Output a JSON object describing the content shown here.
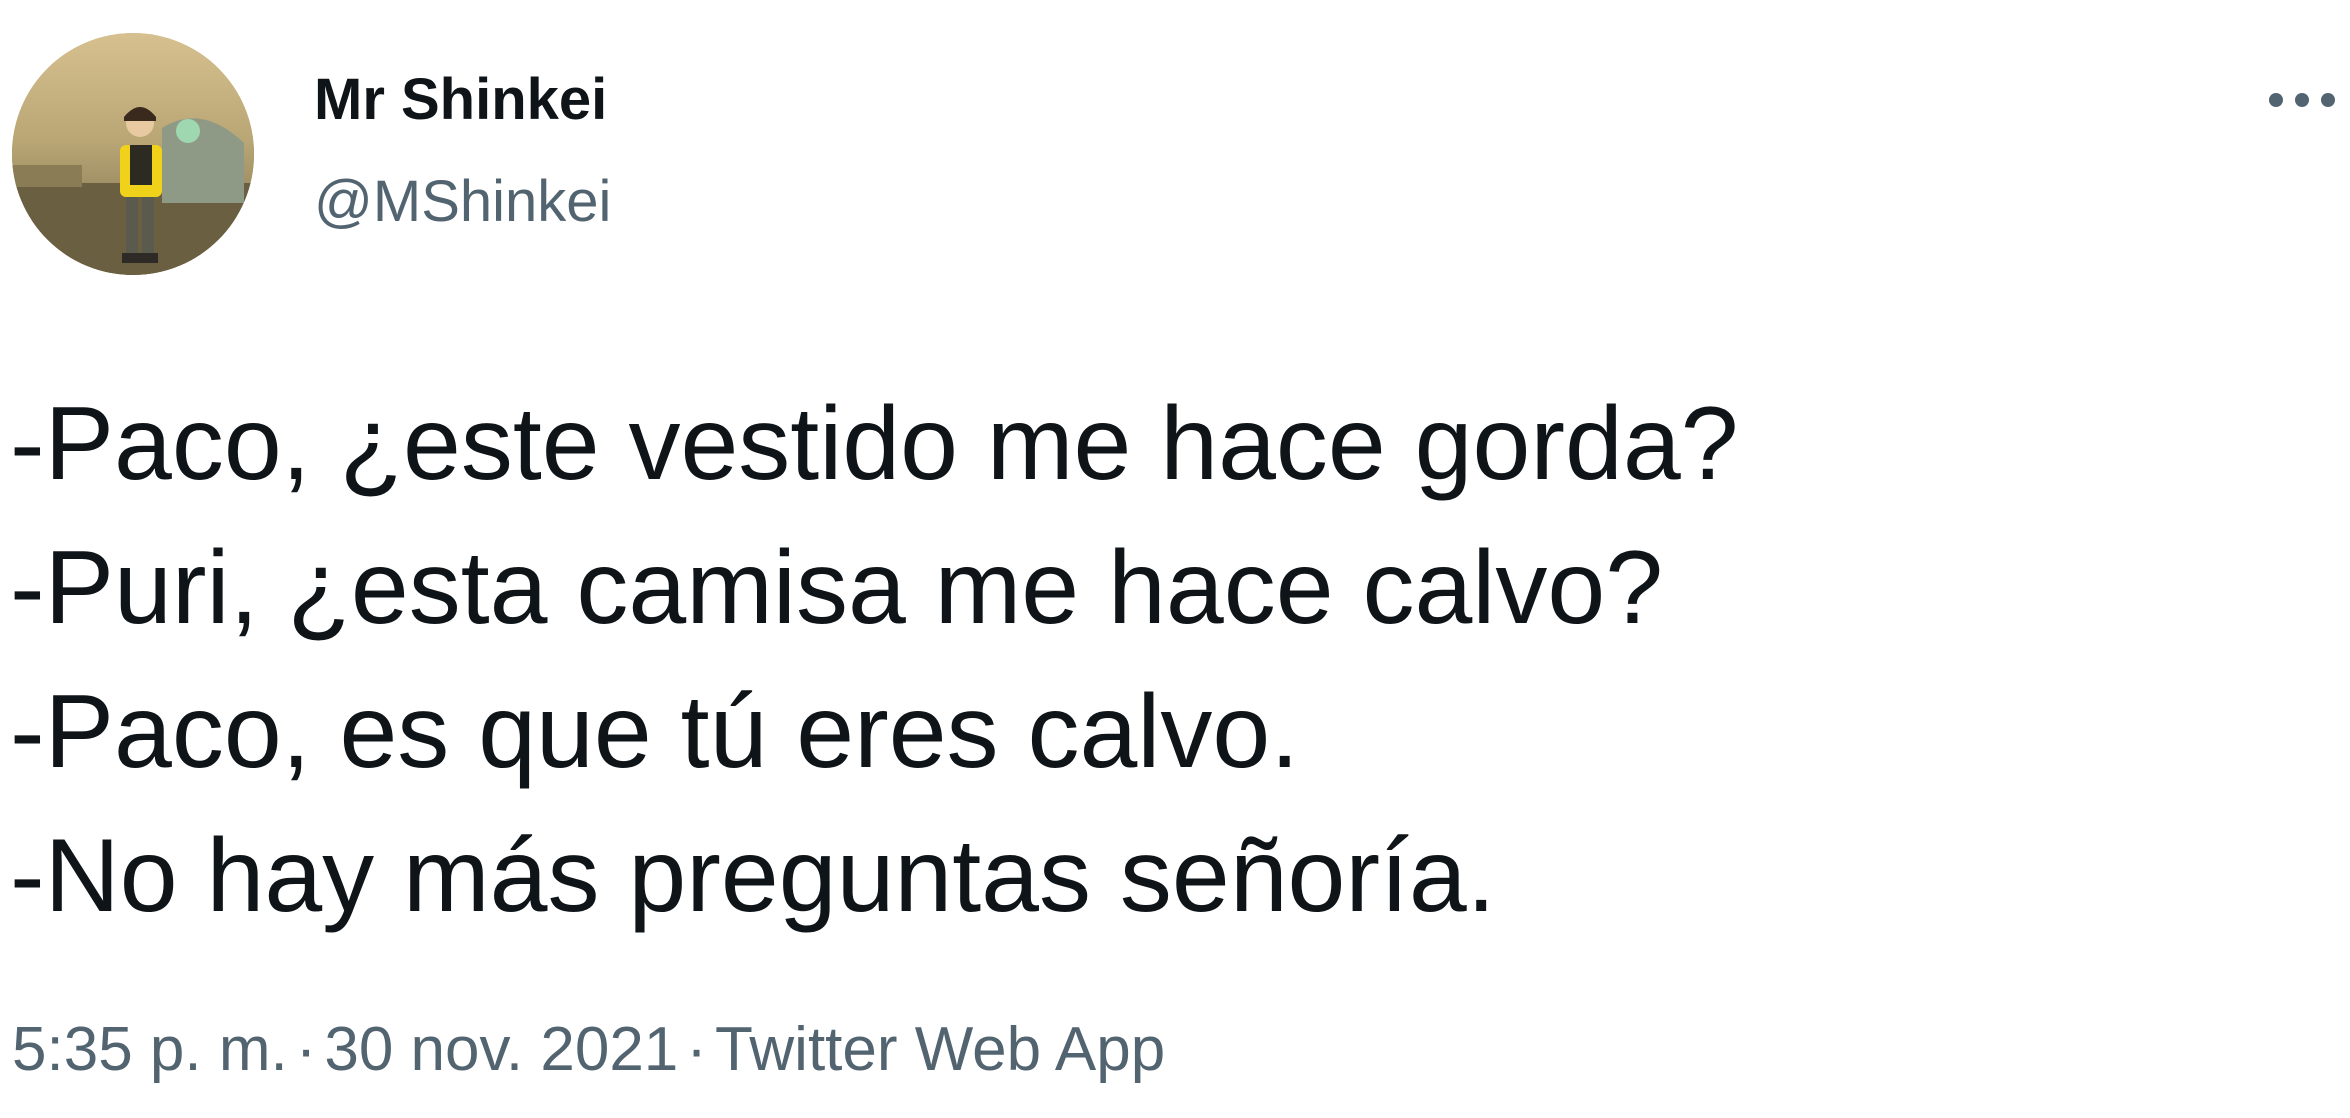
{
  "author": {
    "display_name": "Mr Shinkei",
    "handle": "@MShinkei",
    "avatar_icon": "profile-avatar"
  },
  "more_icon": "more-horizontal-icon",
  "tweet": {
    "lines": [
      "-Paco, ¿este vestido me hace gorda?",
      "-Puri, ¿esta camisa me hace calvo?",
      "-Paco, es que tú eres calvo.",
      "-No hay más preguntas señoría."
    ]
  },
  "meta": {
    "time": "5:35 p. m.",
    "separator": "·",
    "date": "30 nov. 2021",
    "source": "Twitter Web App"
  },
  "colors": {
    "text": "#0f1419",
    "secondary": "#536471"
  }
}
